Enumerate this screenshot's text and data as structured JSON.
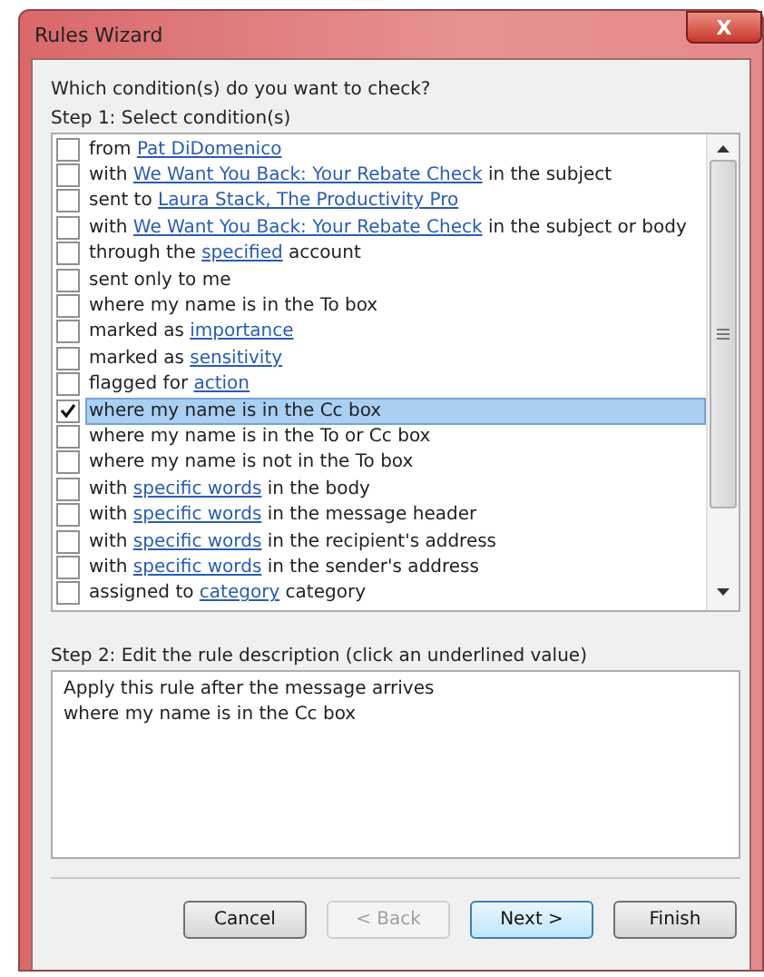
{
  "window": {
    "title": "Rules Wizard",
    "close": "X"
  },
  "prompt": "Which condition(s) do you want to check?",
  "step1_label": "Step 1: Select condition(s)",
  "conditions": [
    {
      "checked": false,
      "selected": false,
      "parts": [
        {
          "text": "from "
        },
        {
          "text": "Pat DiDomenico",
          "link": true
        }
      ]
    },
    {
      "checked": false,
      "selected": false,
      "parts": [
        {
          "text": "with "
        },
        {
          "text": "We Want You Back: Your Rebate Check",
          "link": true
        },
        {
          "text": " in the subject"
        }
      ]
    },
    {
      "checked": false,
      "selected": false,
      "parts": [
        {
          "text": "sent to "
        },
        {
          "text": "Laura Stack, The Productivity Pro",
          "link": true
        }
      ]
    },
    {
      "checked": false,
      "selected": false,
      "parts": [
        {
          "text": "with "
        },
        {
          "text": "We Want You Back: Your Rebate Check",
          "link": true
        },
        {
          "text": " in the subject or body"
        }
      ]
    },
    {
      "checked": false,
      "selected": false,
      "parts": [
        {
          "text": "through the "
        },
        {
          "text": "specified",
          "link": true
        },
        {
          "text": " account"
        }
      ]
    },
    {
      "checked": false,
      "selected": false,
      "parts": [
        {
          "text": "sent only to me"
        }
      ]
    },
    {
      "checked": false,
      "selected": false,
      "parts": [
        {
          "text": "where my name is in the To box"
        }
      ]
    },
    {
      "checked": false,
      "selected": false,
      "parts": [
        {
          "text": "marked as "
        },
        {
          "text": "importance",
          "link": true
        }
      ]
    },
    {
      "checked": false,
      "selected": false,
      "parts": [
        {
          "text": "marked as "
        },
        {
          "text": "sensitivity",
          "link": true
        }
      ]
    },
    {
      "checked": false,
      "selected": false,
      "parts": [
        {
          "text": "flagged for "
        },
        {
          "text": "action",
          "link": true
        }
      ]
    },
    {
      "checked": true,
      "selected": true,
      "parts": [
        {
          "text": "where my name is in the Cc box"
        }
      ]
    },
    {
      "checked": false,
      "selected": false,
      "parts": [
        {
          "text": "where my name is in the To or Cc box"
        }
      ]
    },
    {
      "checked": false,
      "selected": false,
      "parts": [
        {
          "text": "where my name is not in the To box"
        }
      ]
    },
    {
      "checked": false,
      "selected": false,
      "parts": [
        {
          "text": "with "
        },
        {
          "text": "specific words",
          "link": true
        },
        {
          "text": " in the body"
        }
      ]
    },
    {
      "checked": false,
      "selected": false,
      "parts": [
        {
          "text": "with "
        },
        {
          "text": "specific words",
          "link": true
        },
        {
          "text": " in the message header"
        }
      ]
    },
    {
      "checked": false,
      "selected": false,
      "parts": [
        {
          "text": "with "
        },
        {
          "text": "specific words",
          "link": true
        },
        {
          "text": " in the recipient's address"
        }
      ]
    },
    {
      "checked": false,
      "selected": false,
      "parts": [
        {
          "text": "with "
        },
        {
          "text": "specific words",
          "link": true
        },
        {
          "text": " in the sender's address"
        }
      ]
    },
    {
      "checked": false,
      "selected": false,
      "parts": [
        {
          "text": "assigned to "
        },
        {
          "text": "category",
          "link": true
        },
        {
          "text": " category"
        }
      ]
    }
  ],
  "step2_label": "Step 2: Edit the rule description (click an underlined value)",
  "description_lines": [
    "Apply this rule after the message arrives",
    "where my name is in the Cc box"
  ],
  "buttons": [
    {
      "label": "Cancel",
      "disabled": false,
      "default": false
    },
    {
      "label": "< Back",
      "disabled": true,
      "default": false
    },
    {
      "label": "Next >",
      "disabled": false,
      "default": true
    },
    {
      "label": "Finish",
      "disabled": false,
      "default": false
    }
  ]
}
